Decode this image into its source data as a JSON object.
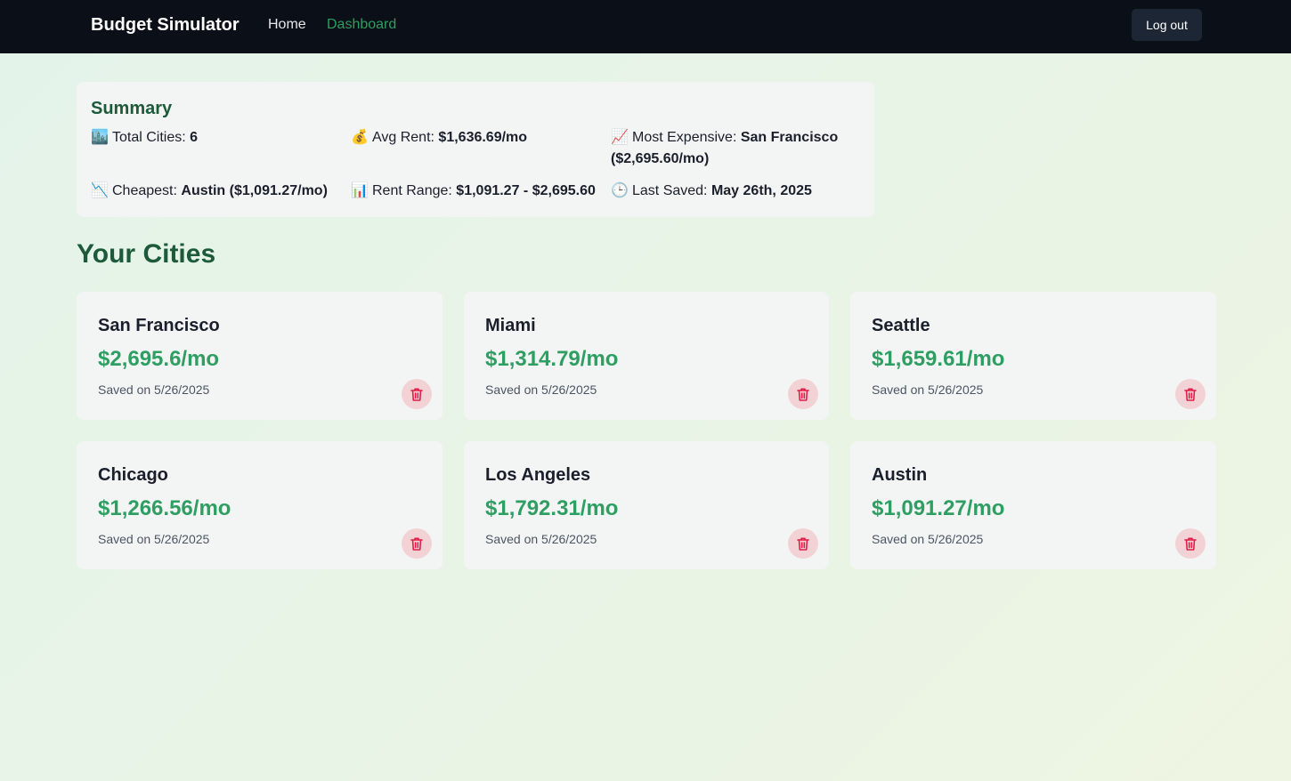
{
  "navbar": {
    "brand": "Budget Simulator",
    "links": [
      {
        "label": "Home",
        "active": false
      },
      {
        "label": "Dashboard",
        "active": true
      }
    ],
    "logout_label": "Log out"
  },
  "summary": {
    "title": "Summary",
    "stats": [
      {
        "icon": "city-icon",
        "emoji": "🏙️",
        "label": "Total Cities:",
        "value": "6"
      },
      {
        "icon": "money-bag-icon",
        "emoji": "💰",
        "label": "Avg Rent:",
        "value": "$1,636.69/mo"
      },
      {
        "icon": "chart-up-icon",
        "emoji": "📈",
        "label": "Most Expensive:",
        "value": "San Francisco ($2,695.60/mo)"
      },
      {
        "icon": "chart-down-icon",
        "emoji": "📉",
        "label": "Cheapest:",
        "value": "Austin ($1,091.27/mo)"
      },
      {
        "icon": "bar-chart-icon",
        "emoji": "📊",
        "label": "Rent Range:",
        "value": "$1,091.27 - $2,695.60"
      },
      {
        "icon": "clock-icon",
        "emoji": "🕒",
        "label": "Last Saved:",
        "value": "May 26th, 2025"
      }
    ]
  },
  "section_title": "Your Cities",
  "cities": [
    {
      "name": "San Francisco",
      "rent": "$2,695.6/mo",
      "saved": "Saved on 5/26/2025"
    },
    {
      "name": "Miami",
      "rent": "$1,314.79/mo",
      "saved": "Saved on 5/26/2025"
    },
    {
      "name": "Seattle",
      "rent": "$1,659.61/mo",
      "saved": "Saved on 5/26/2025"
    },
    {
      "name": "Chicago",
      "rent": "$1,266.56/mo",
      "saved": "Saved on 5/26/2025"
    },
    {
      "name": "Los Angeles",
      "rent": "$1,792.31/mo",
      "saved": "Saved on 5/26/2025"
    },
    {
      "name": "Austin",
      "rent": "$1,091.27/mo",
      "saved": "Saved on 5/26/2025"
    }
  ],
  "colors": {
    "navbar_bg": "#0b0f17",
    "accent_green": "#2f9e62",
    "heading_green": "#1c5a3a",
    "delete_red": "#e11d48",
    "card_bg": "#f3f5f4"
  }
}
